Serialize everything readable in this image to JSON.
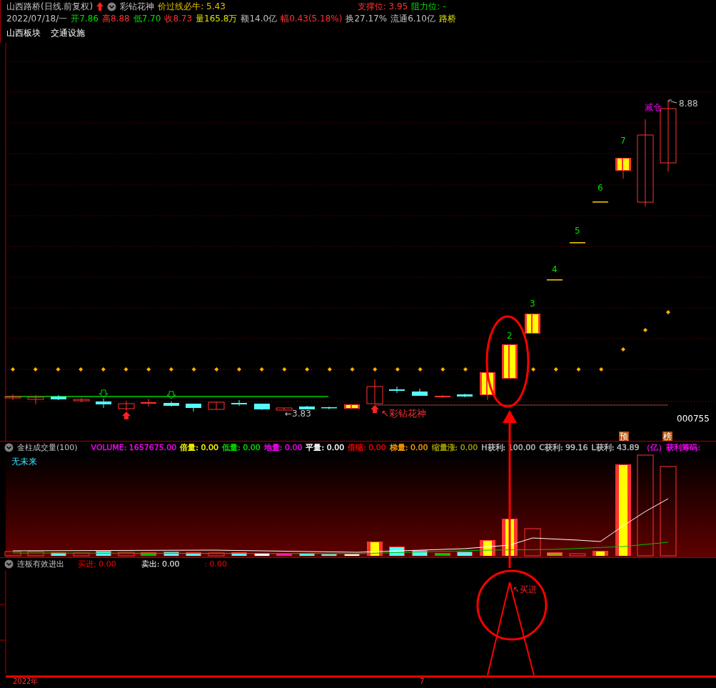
{
  "header": {
    "title": "山西路桥(日线.前复权)",
    "indicator": "彩钻花神",
    "formula": "价过线必牛: 5.43",
    "support": "支撑位: 3.95",
    "resistance": "阻力位: -"
  },
  "quote": [
    {
      "text": "2022/07/18/一",
      "color": "#c0c0c0"
    },
    {
      "text": "开7.86",
      "color": "#00e000"
    },
    {
      "text": "高8.88",
      "color": "#ff3232"
    },
    {
      "text": "低7.70",
      "color": "#00e000"
    },
    {
      "text": "收8.73",
      "color": "#ff3232"
    },
    {
      "text": "量165.8万",
      "color": "#e0e000"
    },
    {
      "text": "额14.0亿",
      "color": "#c0c0c0"
    },
    {
      "text": "幅0.43(5.18%)",
      "color": "#ff3232"
    },
    {
      "text": "换27.17%",
      "color": "#c0c0c0"
    },
    {
      "text": "流通6.10亿",
      "color": "#c0c0c0"
    },
    {
      "text": "路桥",
      "color": "#e0e000"
    }
  ],
  "sectors": [
    "山西板块",
    "交通设施"
  ],
  "price_chart": {
    "low_label": "←3.83",
    "signal_label": "↖彩钻花神",
    "counts": [
      "2",
      "3",
      "4",
      "5",
      "6",
      "7"
    ],
    "reduce_label": "减仓",
    "high_label": "8.88",
    "code": "000755",
    "badges": [
      "预",
      "榜"
    ]
  },
  "volume_panel": {
    "title": "金柱成交量(100)",
    "items": [
      {
        "text": "VOLUME: 1657675.00",
        "color": "#ff00ff"
      },
      {
        "text": "倍量: 0.00",
        "color": "#ffff00"
      },
      {
        "text": "低量: 0.00",
        "color": "#00e000"
      },
      {
        "text": "地量: 0.00",
        "color": "#ff00ff"
      },
      {
        "text": "平量: 0.00",
        "color": "#ffffff"
      },
      {
        "text": "倍缩: 0.00",
        "color": "#ff0000"
      },
      {
        "text": "梯量: 0.00",
        "color": "#ffa000"
      },
      {
        "text": "缩量涨: 0.00",
        "color": "#a0a000"
      },
      {
        "text": "H获利: 100.00",
        "color": "#c0c0c0"
      },
      {
        "text": "C获利: 99.16",
        "color": "#c0c0c0"
      },
      {
        "text": "L获利: 43.89",
        "color": "#c0c0c0"
      },
      {
        "text": "（亿）获利筹码:",
        "color": "#ff00ff"
      }
    ],
    "note": "无未来"
  },
  "signal_panel": {
    "title": "连板有效进出",
    "items": [
      {
        "text": "买进: 0.00",
        "color": "#ff0000"
      },
      {
        "text": "卖出: 0.00",
        "color": "#ffffff"
      },
      {
        "text": ": 0.00",
        "color": "#ff0000"
      }
    ],
    "annotation": "↖买进"
  },
  "axis": {
    "year": "2022年",
    "month": "7"
  }
}
